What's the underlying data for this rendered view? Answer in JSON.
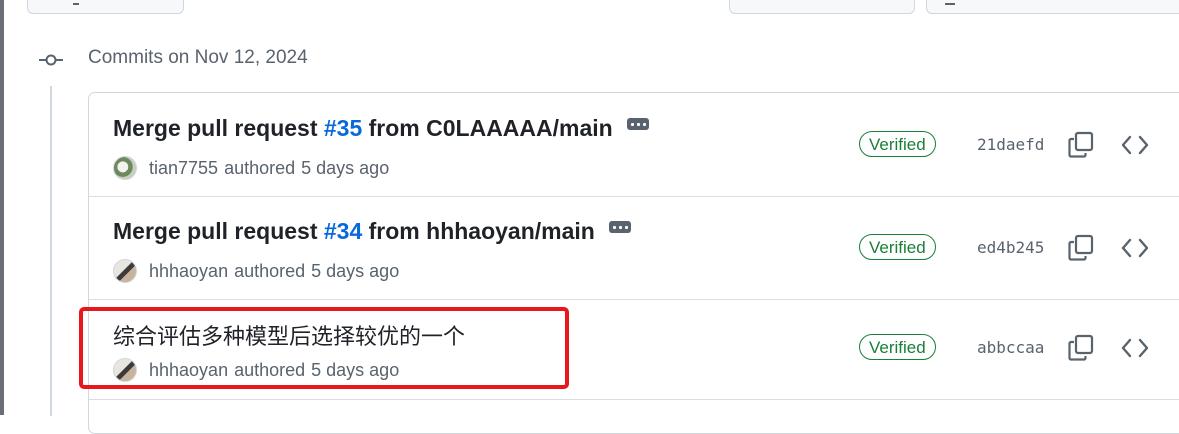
{
  "timeline": {
    "day_title": "Commits on Nov 12, 2024"
  },
  "commits": [
    {
      "title_prefix": "Merge pull request ",
      "pr_number": "#35",
      "title_suffix": " from C0LAAAAA/main",
      "author": "tian7755",
      "authored_label": "authored",
      "time": "5 days ago",
      "verified_label": "Verified",
      "sha": "21daefd"
    },
    {
      "title_prefix": "Merge pull request ",
      "pr_number": "#34",
      "title_suffix": " from hhhaoyan/main",
      "author": "hhhaoyan",
      "authored_label": "authored",
      "time": "5 days ago",
      "verified_label": "Verified",
      "sha": "ed4b245"
    },
    {
      "title": "综合评估多种模型后选择较优的一个",
      "author": "hhhaoyan",
      "authored_label": "authored",
      "time": "5 days ago",
      "verified_label": "Verified",
      "sha": "abbccaa"
    }
  ],
  "icons": {
    "commit_node": "git-commit-icon",
    "ellipsis": "kebab-horizontal-icon",
    "copy": "copy-icon",
    "browse": "code-icon"
  },
  "colors": {
    "link": "#0969da",
    "verified": "#1a7f37",
    "highlight": "#e8171b",
    "muted": "#59636e",
    "border": "#d0d7de"
  }
}
